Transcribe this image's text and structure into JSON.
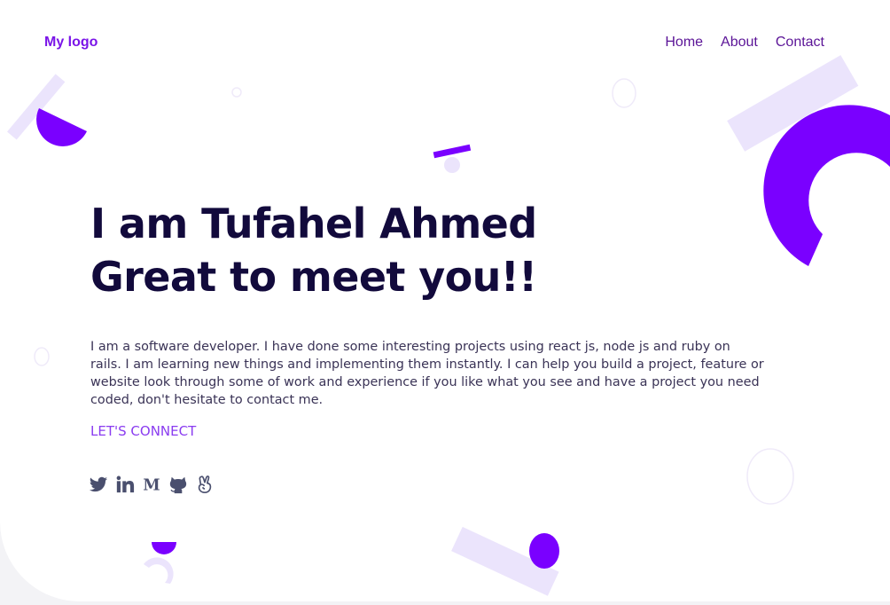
{
  "header": {
    "logo": "My logo",
    "nav": [
      {
        "label": "Home"
      },
      {
        "label": "About"
      },
      {
        "label": "Contact"
      }
    ]
  },
  "hero": {
    "title_line1": "I am Tufahel Ahmed",
    "title_line2": "Great to meet you!!",
    "bio": "I am a software developer. I have done some interesting projects using react js, node js and ruby on rails. I am learning new things and implementing them instantly. I can help you build a project, feature or website look through some of work and experience if you like what you see and have a project you need coded, don't hesitate to contact me.",
    "cta": "LET'S CONNECT"
  },
  "social_icons": [
    "twitter-icon",
    "linkedin-icon",
    "medium-icon",
    "github-icon",
    "angellist-icon"
  ],
  "colors": {
    "accent": "#7a00ff",
    "accent_light": "#ebe4fc",
    "heading": "#120a3c",
    "nav_text": "#5b1497",
    "icon": "#4a4f6e"
  }
}
